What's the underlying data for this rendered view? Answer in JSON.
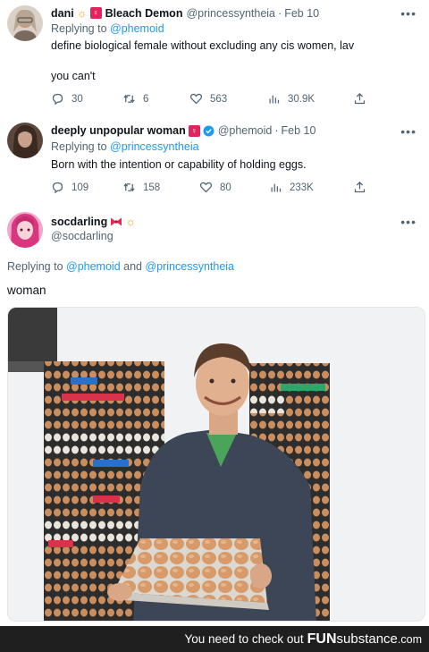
{
  "tweet1": {
    "name": "dani",
    "name_extra": "Bleach Demon",
    "handle": "@princessyntheia",
    "date": "Feb 10",
    "reply_prefix": "Replying to ",
    "reply_handle": "@phemoid",
    "line1": "define biological female without excluding any cis women, lav",
    "line2": "you can't",
    "replies": "30",
    "retweets": "6",
    "likes": "563",
    "views": "30.9K"
  },
  "tweet2": {
    "name": "deeply unpopular woman",
    "handle": "@phemoid",
    "date": "Feb 10",
    "reply_prefix": "Replying to ",
    "reply_handle": "@princessyntheia",
    "text": "Born with the intention or capability of holding eggs.",
    "replies": "109",
    "retweets": "158",
    "likes": "80",
    "views": "233K"
  },
  "tweet3": {
    "name": "socdarling",
    "handle": "@socdarling",
    "reply_prefix": "Replying to ",
    "reply_handle1": "@phemoid",
    "reply_and": " and ",
    "reply_handle2": "@princessyntheia",
    "text": "woman"
  },
  "common": {
    "dot": "·",
    "more": "•••",
    "female_sign": "♀",
    "sun": "☼"
  },
  "footer": {
    "prefix": "You need to check out ",
    "brand_fun": "FUN",
    "brand_rest": "substance",
    "domain": ".com"
  },
  "colors": {
    "link": "#1d9bf0",
    "muted": "#536471",
    "badge": "#e0245e",
    "footer_bg": "#1f1f1f"
  }
}
